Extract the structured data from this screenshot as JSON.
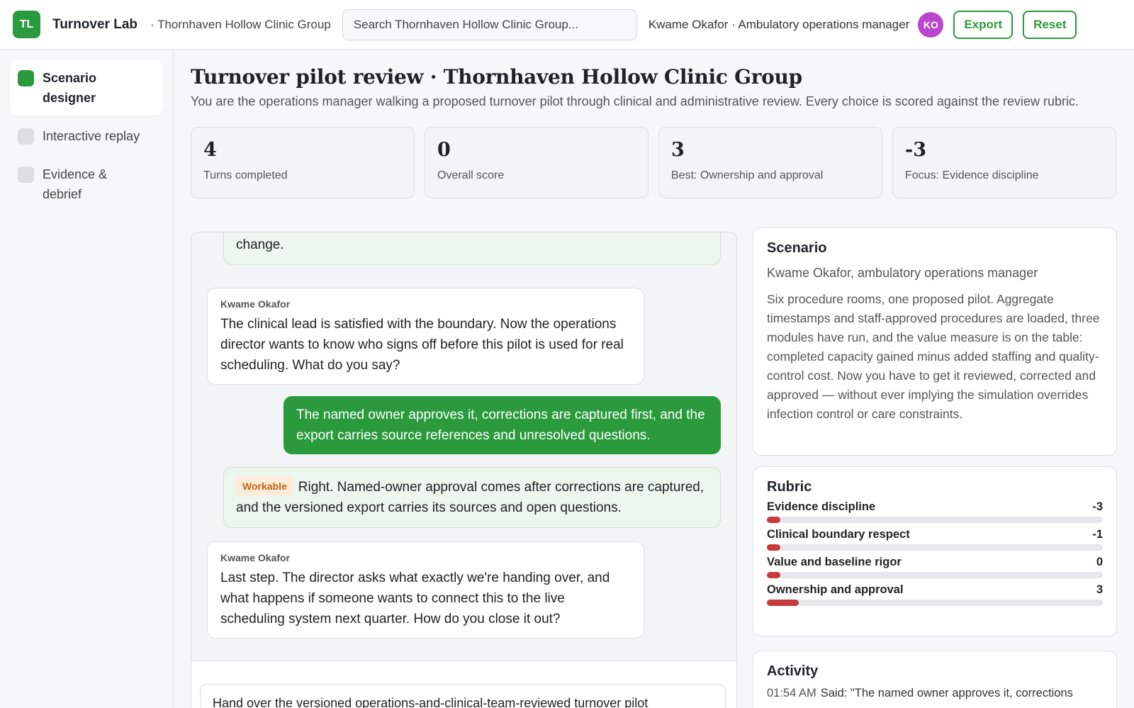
{
  "app": {
    "logo": "TL",
    "name": "Turnover Lab",
    "org": "· Thornhaven Hollow Clinic Group",
    "search_placeholder": "Search Thornhaven Hollow Clinic Group...",
    "user": "Kwame Okafor · Ambulatory operations manager",
    "avatar": "KO",
    "export_label": "Export",
    "reset_label": "Reset"
  },
  "sidebar": {
    "items": [
      {
        "label": "Scenario designer",
        "active": true
      },
      {
        "label": "Interactive replay",
        "active": false
      },
      {
        "label": "Evidence & debrief",
        "active": false
      }
    ]
  },
  "page": {
    "title": "Turnover pilot review · Thornhaven Hollow Clinic Group",
    "subtitle": "You are the operations manager walking a proposed turnover pilot through clinical and administrative review. Every choice is scored against the review rubric."
  },
  "stats": [
    {
      "value": "4",
      "label": "Turns completed"
    },
    {
      "value": "0",
      "label": "Overall score"
    },
    {
      "value": "3",
      "label": "Best: Ownership and approval"
    },
    {
      "value": "-3",
      "label": "Focus: Evidence discipline"
    }
  ],
  "chat": {
    "msg1_text": "administrative turnover stages; clinical constraints are never the model's to change.",
    "msg2_speaker": "Kwame Okafor",
    "msg2_text": "The clinical lead is satisfied with the boundary. Now the operations director wants to know who signs off before this pilot is used for real scheduling. What do you say?",
    "msg3_text": "The named owner approves it, corrections are captured first, and the export carries source references and unresolved questions.",
    "msg4_badge": "Workable",
    "msg4_text": "Right. Named-owner approval comes after corrections are captured, and the versioned export carries its sources and open questions.",
    "msg5_speaker": "Kwame Okafor",
    "msg5_text": "Last step. The director asks what exactly we're handing over, and what happens if someone wants to connect this to the live scheduling system next quarter. How do you close it out?",
    "composer_value": "Hand over the versioned operations-and-clinical-team-reviewed turnover pilot"
  },
  "scenario": {
    "title": "Scenario",
    "role": "Kwame Okafor, ambulatory operations manager",
    "body": "Six procedure rooms, one proposed pilot. Aggregate timestamps and staff-approved procedures are loaded, three modules have run, and the value measure is on the table: completed capacity gained minus added staffing and quality-control cost. Now you have to get it reviewed, corrected and approved — without ever implying the simulation overrides infection control or care constraints."
  },
  "rubric": {
    "title": "Rubric",
    "items": [
      {
        "label": "Evidence discipline",
        "score": "-3",
        "value": -3
      },
      {
        "label": "Clinical boundary respect",
        "score": "-1",
        "value": -1
      },
      {
        "label": "Value and baseline rigor",
        "score": "0",
        "value": 0
      },
      {
        "label": "Ownership and approval",
        "score": "3",
        "value": 3
      }
    ]
  },
  "activity": {
    "title": "Activity",
    "items": [
      {
        "time": "01:54 AM",
        "text": "Said: \"The named owner approves it, corrections"
      }
    ]
  },
  "colors": {
    "accent": "#2a9a3d",
    "avatar": "#b846cf",
    "rubric_fill": "#c63b3b",
    "badge_text": "#c0640f"
  }
}
